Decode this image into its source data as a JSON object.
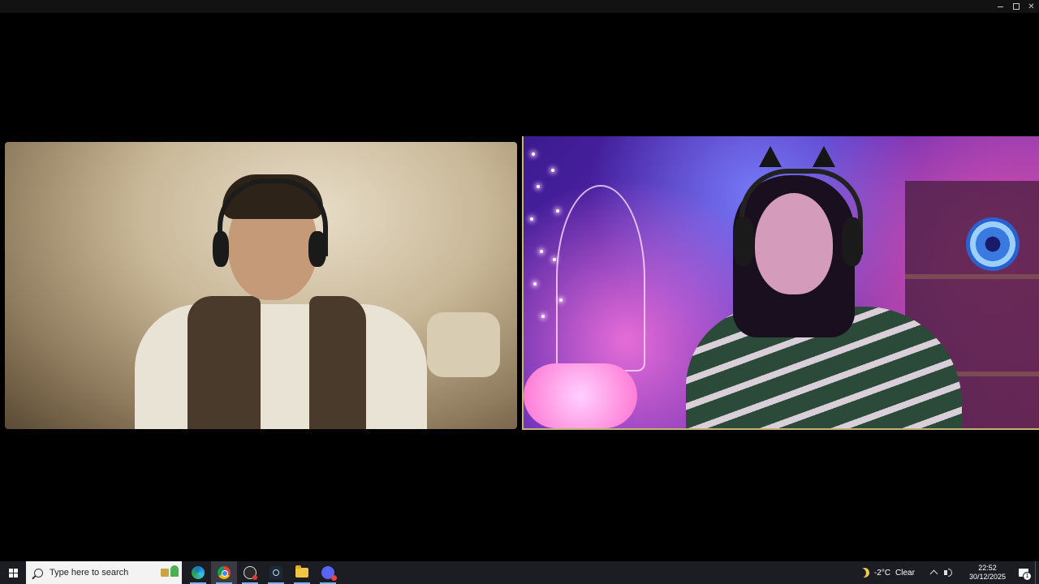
{
  "window": {
    "controls": [
      "minimize-icon",
      "maximize-icon",
      "close-icon"
    ]
  },
  "video_tiles": [
    {
      "id": "participant-left",
      "border_color": ""
    },
    {
      "id": "participant-right",
      "border_color": "#c9b27a"
    }
  ],
  "taskbar": {
    "search_placeholder": "Type here to search",
    "apps": [
      {
        "name": "edge-icon",
        "running": true,
        "active": false
      },
      {
        "name": "chrome-icon",
        "running": true,
        "active": true
      },
      {
        "name": "obs-icon",
        "running": true,
        "active": false
      },
      {
        "name": "steam-icon",
        "running": true,
        "active": false
      },
      {
        "name": "file-explorer-icon",
        "running": true,
        "active": false
      },
      {
        "name": "discord-icon",
        "running": true,
        "active": false
      }
    ],
    "weather": {
      "icon": "moon-icon",
      "temperature": "-2°C",
      "condition": "Clear"
    },
    "clock": {
      "time": "22:52",
      "date": "30/12/2025"
    },
    "notifications": {
      "count": "1"
    }
  },
  "colors": {
    "taskbar_bg": "#1c1d22",
    "window_bg": "#000000",
    "running_indicator": "#7fb0ee"
  }
}
